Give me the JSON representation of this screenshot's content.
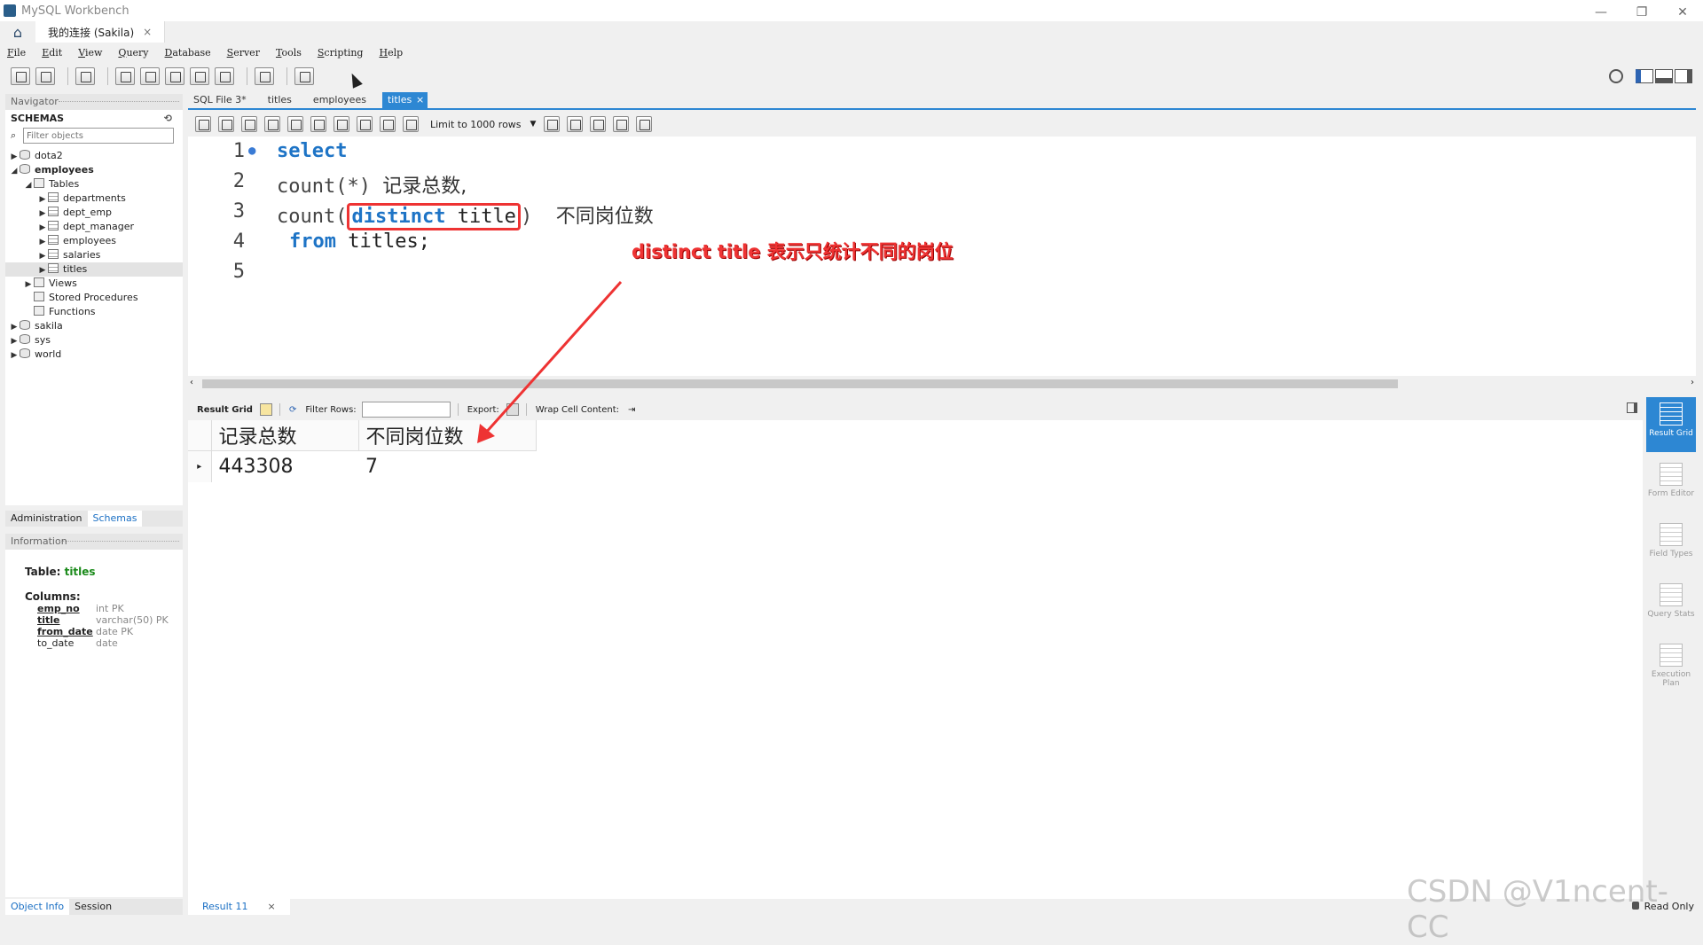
{
  "app": {
    "title": "MySQL Workbench"
  },
  "connection_tab": {
    "label": "我的连接 (Sakila)",
    "close": "×"
  },
  "window_controls": {
    "minimize": "—",
    "restore": "❐",
    "close": "✕"
  },
  "menu": [
    "File",
    "Edit",
    "View",
    "Query",
    "Database",
    "Server",
    "Tools",
    "Scripting",
    "Help"
  ],
  "navigator": {
    "header": "Navigator",
    "schemas_title": "SCHEMAS",
    "filter_placeholder": "Filter objects",
    "tree": [
      {
        "label": "dota2",
        "level": 0,
        "expanded": false,
        "type": "db",
        "bold": false
      },
      {
        "label": "employees",
        "level": 0,
        "expanded": true,
        "type": "db",
        "bold": true
      },
      {
        "label": "Tables",
        "level": 1,
        "expanded": true,
        "type": "folder",
        "bold": false
      },
      {
        "label": "departments",
        "level": 2,
        "expanded": false,
        "type": "table",
        "bold": false
      },
      {
        "label": "dept_emp",
        "level": 2,
        "expanded": false,
        "type": "table",
        "bold": false
      },
      {
        "label": "dept_manager",
        "level": 2,
        "expanded": false,
        "type": "table",
        "bold": false
      },
      {
        "label": "employees",
        "level": 2,
        "expanded": false,
        "type": "table",
        "bold": false
      },
      {
        "label": "salaries",
        "level": 2,
        "expanded": false,
        "type": "table",
        "bold": false
      },
      {
        "label": "titles",
        "level": 2,
        "expanded": false,
        "type": "table",
        "bold": false,
        "selected": true
      },
      {
        "label": "Views",
        "level": 1,
        "expanded": false,
        "type": "folder",
        "bold": false
      },
      {
        "label": "Stored Procedures",
        "level": 1,
        "expanded": null,
        "type": "folder",
        "bold": false
      },
      {
        "label": "Functions",
        "level": 1,
        "expanded": null,
        "type": "folder",
        "bold": false
      },
      {
        "label": "sakila",
        "level": 0,
        "expanded": false,
        "type": "db",
        "bold": false
      },
      {
        "label": "sys",
        "level": 0,
        "expanded": false,
        "type": "db",
        "bold": false
      },
      {
        "label": "world",
        "level": 0,
        "expanded": false,
        "type": "db",
        "bold": false
      }
    ],
    "tabs": [
      "Administration",
      "Schemas"
    ]
  },
  "information": {
    "header": "Information",
    "table_label": "Table:",
    "table_name": "titles",
    "columns_label": "Columns:",
    "columns": [
      {
        "name": "emp_no",
        "type": "int PK",
        "key": true
      },
      {
        "name": "title",
        "type": "varchar(50) PK",
        "key": true
      },
      {
        "name": "from_date",
        "type": "date PK",
        "key": true
      },
      {
        "name": "to_date",
        "type": "date",
        "key": false
      }
    ],
    "bottom_tabs": [
      "Object Info",
      "Session"
    ]
  },
  "doc_tabs": [
    "SQL File 3*",
    "titles",
    "employees",
    "titles"
  ],
  "active_doc_tab": 3,
  "sql_toolbar": {
    "limit_label": "Limit to 1000 rows"
  },
  "editor": {
    "line_numbers": [
      "1",
      "2",
      "3",
      "4",
      "5"
    ],
    "l1_kw": "select",
    "l2_fn": "count(*)",
    "l2_alias": "记录总数,",
    "l3_fn_open": "count(",
    "l3_kw": "distinct",
    "l3_col": "title",
    "l3_close": ")",
    "l3_alias": "不同岗位数",
    "l4_kw": "from",
    "l4_tbl": "titles;",
    "annotation": "distinct title 表示只统计不同的岗位"
  },
  "result_toolbar": {
    "result_grid": "Result Grid",
    "filter_rows": "Filter Rows:",
    "export": "Export:",
    "wrap": "Wrap Cell Content:"
  },
  "result_grid": {
    "headers": [
      "记录总数",
      "不同岗位数"
    ],
    "rows": [
      [
        "443308",
        "7"
      ]
    ]
  },
  "right_sidebar": [
    {
      "label": "Result Grid",
      "active": true
    },
    {
      "label": "Form Editor",
      "active": false
    },
    {
      "label": "Field Types",
      "active": false
    },
    {
      "label": "Query Stats",
      "active": false
    },
    {
      "label": "Execution Plan",
      "active": false
    }
  ],
  "result_tab": {
    "label": "Result 11",
    "close": "×"
  },
  "status": {
    "read_only": "Read Only"
  },
  "watermark": "CSDN @V1ncent-CC",
  "colors": {
    "accent": "#2d87d3",
    "keyword": "#1e74c6",
    "annotation": "#ee3333"
  }
}
